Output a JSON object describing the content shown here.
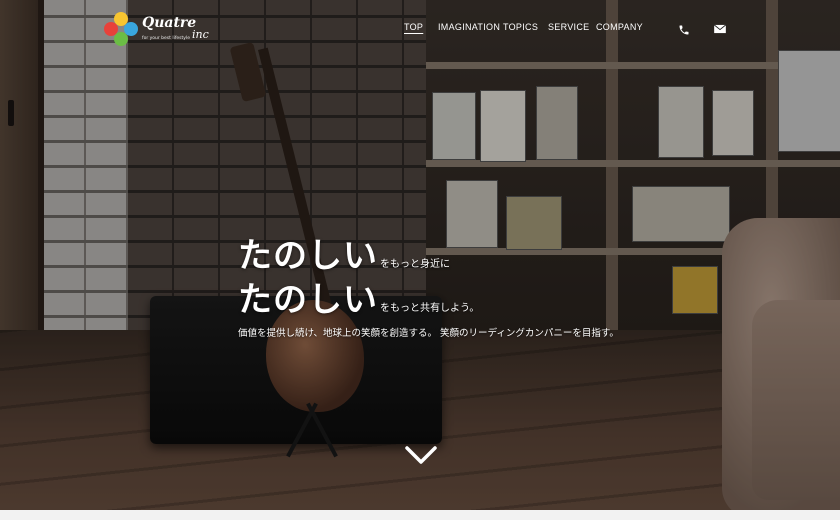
{
  "brand": {
    "name": "Quatre",
    "tagline": "for your best lifestyle",
    "suffix": "inc",
    "petal_colors": [
      "#f7c531",
      "#e8413a",
      "#39a6de",
      "#6bbd45"
    ]
  },
  "nav": {
    "items": [
      {
        "label": "TOP",
        "active": true
      },
      {
        "label": "IMAGINATION",
        "active": false
      },
      {
        "label": "TOPICS",
        "active": false
      },
      {
        "label": "SERVICE",
        "active": false
      },
      {
        "label": "COMPANY",
        "active": false
      }
    ],
    "icons": [
      "phone-icon",
      "mail-icon"
    ]
  },
  "hero": {
    "line1_big": "たのしい",
    "line1_small": "をもっと身近に",
    "line2_big": "たのしい",
    "line2_small": "をもっと共有しよう。",
    "tagline": "価値を提供し続け、地球上の笑顔を創造する。 笑顔のリーディングカンパニーを目指す。",
    "scroll_icon": "chevron-down-icon"
  },
  "colors": {
    "text": "#ffffff"
  }
}
